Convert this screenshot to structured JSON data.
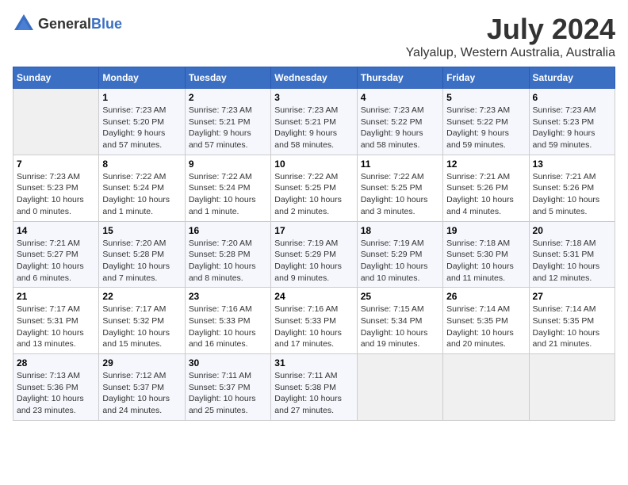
{
  "header": {
    "logo_general": "General",
    "logo_blue": "Blue",
    "month_title": "July 2024",
    "location": "Yalyalup, Western Australia, Australia"
  },
  "days_of_week": [
    "Sunday",
    "Monday",
    "Tuesday",
    "Wednesday",
    "Thursday",
    "Friday",
    "Saturday"
  ],
  "weeks": [
    [
      {
        "day": "",
        "info": ""
      },
      {
        "day": "1",
        "info": "Sunrise: 7:23 AM\nSunset: 5:20 PM\nDaylight: 9 hours\nand 57 minutes."
      },
      {
        "day": "2",
        "info": "Sunrise: 7:23 AM\nSunset: 5:21 PM\nDaylight: 9 hours\nand 57 minutes."
      },
      {
        "day": "3",
        "info": "Sunrise: 7:23 AM\nSunset: 5:21 PM\nDaylight: 9 hours\nand 58 minutes."
      },
      {
        "day": "4",
        "info": "Sunrise: 7:23 AM\nSunset: 5:22 PM\nDaylight: 9 hours\nand 58 minutes."
      },
      {
        "day": "5",
        "info": "Sunrise: 7:23 AM\nSunset: 5:22 PM\nDaylight: 9 hours\nand 59 minutes."
      },
      {
        "day": "6",
        "info": "Sunrise: 7:23 AM\nSunset: 5:23 PM\nDaylight: 9 hours\nand 59 minutes."
      }
    ],
    [
      {
        "day": "7",
        "info": "Sunrise: 7:23 AM\nSunset: 5:23 PM\nDaylight: 10 hours\nand 0 minutes."
      },
      {
        "day": "8",
        "info": "Sunrise: 7:22 AM\nSunset: 5:24 PM\nDaylight: 10 hours\nand 1 minute."
      },
      {
        "day": "9",
        "info": "Sunrise: 7:22 AM\nSunset: 5:24 PM\nDaylight: 10 hours\nand 1 minute."
      },
      {
        "day": "10",
        "info": "Sunrise: 7:22 AM\nSunset: 5:25 PM\nDaylight: 10 hours\nand 2 minutes."
      },
      {
        "day": "11",
        "info": "Sunrise: 7:22 AM\nSunset: 5:25 PM\nDaylight: 10 hours\nand 3 minutes."
      },
      {
        "day": "12",
        "info": "Sunrise: 7:21 AM\nSunset: 5:26 PM\nDaylight: 10 hours\nand 4 minutes."
      },
      {
        "day": "13",
        "info": "Sunrise: 7:21 AM\nSunset: 5:26 PM\nDaylight: 10 hours\nand 5 minutes."
      }
    ],
    [
      {
        "day": "14",
        "info": "Sunrise: 7:21 AM\nSunset: 5:27 PM\nDaylight: 10 hours\nand 6 minutes."
      },
      {
        "day": "15",
        "info": "Sunrise: 7:20 AM\nSunset: 5:28 PM\nDaylight: 10 hours\nand 7 minutes."
      },
      {
        "day": "16",
        "info": "Sunrise: 7:20 AM\nSunset: 5:28 PM\nDaylight: 10 hours\nand 8 minutes."
      },
      {
        "day": "17",
        "info": "Sunrise: 7:19 AM\nSunset: 5:29 PM\nDaylight: 10 hours\nand 9 minutes."
      },
      {
        "day": "18",
        "info": "Sunrise: 7:19 AM\nSunset: 5:29 PM\nDaylight: 10 hours\nand 10 minutes."
      },
      {
        "day": "19",
        "info": "Sunrise: 7:18 AM\nSunset: 5:30 PM\nDaylight: 10 hours\nand 11 minutes."
      },
      {
        "day": "20",
        "info": "Sunrise: 7:18 AM\nSunset: 5:31 PM\nDaylight: 10 hours\nand 12 minutes."
      }
    ],
    [
      {
        "day": "21",
        "info": "Sunrise: 7:17 AM\nSunset: 5:31 PM\nDaylight: 10 hours\nand 13 minutes."
      },
      {
        "day": "22",
        "info": "Sunrise: 7:17 AM\nSunset: 5:32 PM\nDaylight: 10 hours\nand 15 minutes."
      },
      {
        "day": "23",
        "info": "Sunrise: 7:16 AM\nSunset: 5:33 PM\nDaylight: 10 hours\nand 16 minutes."
      },
      {
        "day": "24",
        "info": "Sunrise: 7:16 AM\nSunset: 5:33 PM\nDaylight: 10 hours\nand 17 minutes."
      },
      {
        "day": "25",
        "info": "Sunrise: 7:15 AM\nSunset: 5:34 PM\nDaylight: 10 hours\nand 19 minutes."
      },
      {
        "day": "26",
        "info": "Sunrise: 7:14 AM\nSunset: 5:35 PM\nDaylight: 10 hours\nand 20 minutes."
      },
      {
        "day": "27",
        "info": "Sunrise: 7:14 AM\nSunset: 5:35 PM\nDaylight: 10 hours\nand 21 minutes."
      }
    ],
    [
      {
        "day": "28",
        "info": "Sunrise: 7:13 AM\nSunset: 5:36 PM\nDaylight: 10 hours\nand 23 minutes."
      },
      {
        "day": "29",
        "info": "Sunrise: 7:12 AM\nSunset: 5:37 PM\nDaylight: 10 hours\nand 24 minutes."
      },
      {
        "day": "30",
        "info": "Sunrise: 7:11 AM\nSunset: 5:37 PM\nDaylight: 10 hours\nand 25 minutes."
      },
      {
        "day": "31",
        "info": "Sunrise: 7:11 AM\nSunset: 5:38 PM\nDaylight: 10 hours\nand 27 minutes."
      },
      {
        "day": "",
        "info": ""
      },
      {
        "day": "",
        "info": ""
      },
      {
        "day": "",
        "info": ""
      }
    ]
  ]
}
